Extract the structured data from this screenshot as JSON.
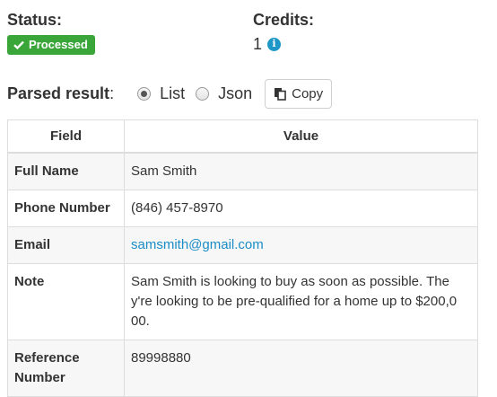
{
  "status": {
    "label": "Status:",
    "badge_text": "Processed",
    "badge_color": "#3aa63a"
  },
  "credits": {
    "label": "Credits:",
    "value": "1",
    "info_icon": "info-icon"
  },
  "parsed": {
    "label": "Parsed result",
    "colon": ":",
    "options": [
      {
        "label": "List",
        "selected": true
      },
      {
        "label": "Json",
        "selected": false
      }
    ],
    "copy_label": "Copy",
    "copy_icon": "copy-icon"
  },
  "table": {
    "headers": [
      "Field",
      "Value"
    ],
    "rows": [
      {
        "field": "Full Name",
        "value": "Sam Smith"
      },
      {
        "field": "Phone Number",
        "value": "(846) 457-8970"
      },
      {
        "field": "Email",
        "value": "samsmith@gmail.com"
      },
      {
        "field": "Note",
        "value": "Sam Smith is looking to buy as soon as possible. The y're looking to be pre-qualified for a home up to $200,0 00."
      },
      {
        "field": "Reference Number",
        "value": "89998880"
      }
    ]
  },
  "colors": {
    "link": "#1b8cc6",
    "info": "#1e96c8"
  }
}
